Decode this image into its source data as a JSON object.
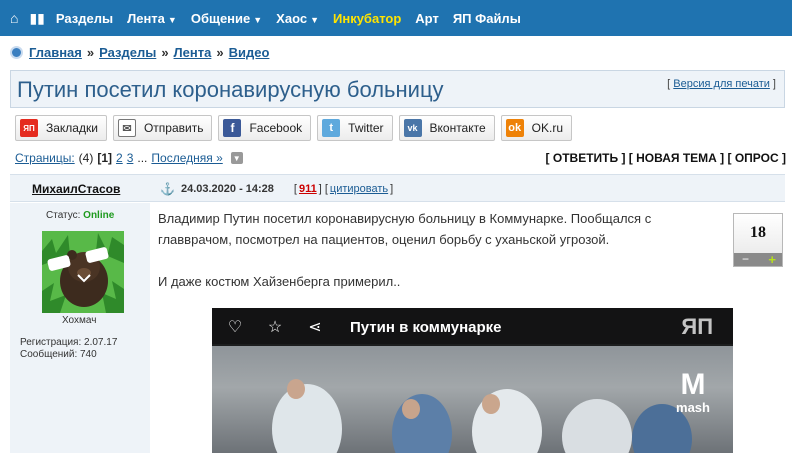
{
  "nav": {
    "home_icon": "home-icon",
    "items": [
      {
        "label": "Разделы",
        "dropdown": false,
        "highlight": false
      },
      {
        "label": "Лента",
        "dropdown": true,
        "highlight": false
      },
      {
        "label": "Общение",
        "dropdown": true,
        "highlight": false
      },
      {
        "label": "Хаос",
        "dropdown": true,
        "highlight": false
      },
      {
        "label": "Инкубатор",
        "dropdown": false,
        "highlight": true
      },
      {
        "label": "Арт",
        "dropdown": false,
        "highlight": false
      },
      {
        "label": "ЯП Файлы",
        "dropdown": false,
        "highlight": false
      }
    ],
    "bg_color": "#1f73b0",
    "highlight_color": "#ffe400"
  },
  "breadcrumb": {
    "items": [
      "Главная",
      "Разделы",
      "Лента",
      "Видео"
    ],
    "separator": "»"
  },
  "topic": {
    "title": "Путин посетил коронавирусную больницу",
    "print_label": "Версия для печати"
  },
  "share": {
    "buttons": [
      {
        "label": "Закладки",
        "icon": "yap-icon",
        "glyph": "ЯП",
        "cls": "yap"
      },
      {
        "label": "Отправить",
        "icon": "mail-icon",
        "glyph": "✉",
        "cls": "mail"
      },
      {
        "label": "Facebook",
        "icon": "facebook-icon",
        "glyph": "f",
        "cls": "fb"
      },
      {
        "label": "Twitter",
        "icon": "twitter-icon",
        "glyph": "t",
        "cls": "tw"
      },
      {
        "label": "Вконтакте",
        "icon": "vk-icon",
        "glyph": "vk",
        "cls": "vk"
      },
      {
        "label": "OK.ru",
        "icon": "ok-icon",
        "glyph": "ok",
        "cls": "ok"
      }
    ]
  },
  "pager": {
    "label": "Страницы:",
    "count": "(4)",
    "current": "[1]",
    "pages": [
      "2",
      "3"
    ],
    "ellipsis": "...",
    "last_label": "Последняя »"
  },
  "actions": {
    "reply": "ОТВЕТИТЬ",
    "new_topic": "НОВАЯ ТЕМА",
    "poll": "ОПРОС"
  },
  "post": {
    "author": "МихаилСтасов",
    "date": "24.03.2020 - 14:28",
    "number": "911",
    "quote_label": "цитировать",
    "paragraphs": [
      "Владимир Путин посетил коронавирусную больницу в Коммунарке. Пообщался с главврачом, посмотрел на пациентов, оценил борьбу с уханьской угрозой.",
      "И даже костюм Хайзенберга примерил.."
    ],
    "rating": "18"
  },
  "user": {
    "status_label": "Статус:",
    "status_value": "Online",
    "rank": "Хохмач",
    "registration": "Регистрация: 2.07.17",
    "messages": "Сообщений: 740"
  },
  "video": {
    "title": "Путин в коммунарке",
    "watermark": "ЯП",
    "brand": "mash",
    "brand_mark": "M"
  }
}
